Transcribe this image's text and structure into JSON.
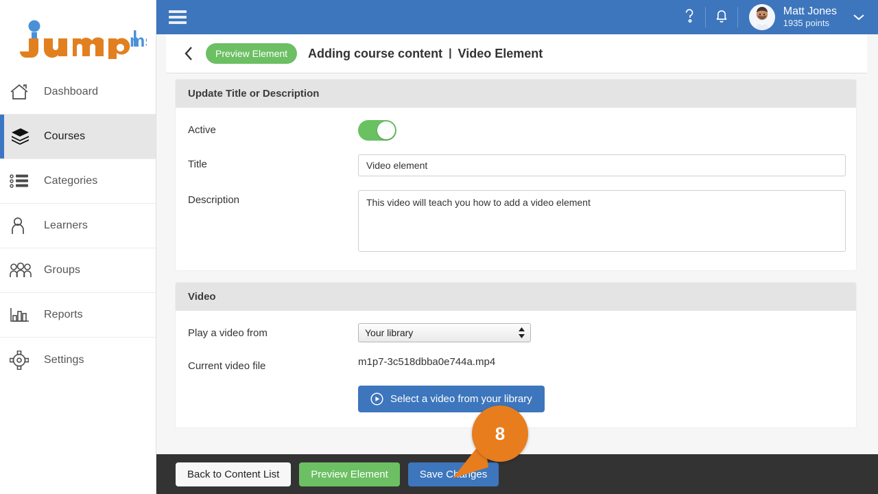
{
  "brand": {
    "logo_main": "jump",
    "logo_suffix": "lms",
    "accent_orange": "#e2801f",
    "accent_blue": "#4a90d9"
  },
  "sidebar": {
    "items": [
      {
        "label": "Dashboard",
        "icon": "home-icon",
        "active": false
      },
      {
        "label": "Courses",
        "icon": "books-icon",
        "active": true
      },
      {
        "label": "Categories",
        "icon": "list-icon",
        "active": false
      },
      {
        "label": "Learners",
        "icon": "person-icon",
        "active": false
      },
      {
        "label": "Groups",
        "icon": "people-icon",
        "active": false
      },
      {
        "label": "Reports",
        "icon": "bar-chart-icon",
        "active": false
      },
      {
        "label": "Settings",
        "icon": "gear-icon",
        "active": false
      }
    ]
  },
  "topbar": {
    "menu_icon": "hamburger-icon",
    "help_icon": "question-mark-icon",
    "notification_icon": "bell-icon",
    "avatar_icon": "user-avatar",
    "user_name": "Matt Jones",
    "user_points": "1935 points",
    "caret_icon": "chevron-down-icon",
    "background": "#3d76bd"
  },
  "breadcrumb": {
    "back_icon": "chevron-left-icon",
    "preview_button": "Preview Element",
    "title": "Adding course content",
    "separator": "|",
    "subtitle": "Video Element"
  },
  "sections": {
    "update": {
      "heading": "Update Title or Description",
      "active_label": "Active",
      "active_state": true,
      "title_label": "Title",
      "title_value": "Video element",
      "description_label": "Description",
      "description_value": "This video will teach you how to add a video element"
    },
    "video": {
      "heading": "Video",
      "play_from_label": "Play a video from",
      "play_from_value": "Your library",
      "current_file_label": "Current video file",
      "current_file_value": "m1p7-3c518dbba0e744a.mp4",
      "select_video_button": "Select a video from your library",
      "select_video_icon": "play-circle-icon"
    }
  },
  "footer": {
    "back_button": "Back to Content List",
    "preview_button": "Preview Element",
    "save_button": "Save Changes"
  },
  "callout": {
    "number": "8",
    "color": "#e87d1e"
  }
}
